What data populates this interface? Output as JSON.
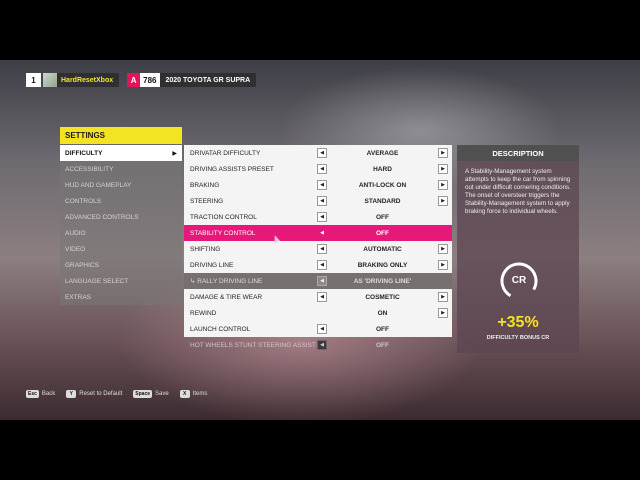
{
  "player": {
    "rank": "1",
    "name": "HardResetXbox",
    "car_class": "A",
    "performance_index": "786",
    "car": "2020 TOYOTA GR SUPRA"
  },
  "menu": {
    "header": "SETTINGS",
    "items": [
      {
        "label": "DIFFICULTY",
        "active": true
      },
      {
        "label": "ACCESSIBILITY"
      },
      {
        "label": "HUD AND GAMEPLAY"
      },
      {
        "label": "CONTROLS"
      },
      {
        "label": "ADVANCED CONTROLS"
      },
      {
        "label": "AUDIO"
      },
      {
        "label": "VIDEO"
      },
      {
        "label": "GRAPHICS"
      },
      {
        "label": "LANGUAGE SELECT"
      },
      {
        "label": "EXTRAS"
      }
    ]
  },
  "options": [
    {
      "label": "DRIVATAR DIFFICULTY",
      "value": "AVERAGE"
    },
    {
      "label": "DRIVING ASSISTS PRESET",
      "value": "HARD"
    },
    {
      "label": "BRAKING",
      "value": "ANTI-LOCK ON"
    },
    {
      "label": "STEERING",
      "value": "STANDARD"
    },
    {
      "label": "TRACTION CONTROL",
      "value": "OFF"
    },
    {
      "label": "STABILITY CONTROL",
      "value": "OFF"
    },
    {
      "label": "SHIFTING",
      "value": "AUTOMATIC"
    },
    {
      "label": "DRIVING LINE",
      "value": "BRAKING ONLY"
    },
    {
      "label": "↳ RALLY DRIVING LINE",
      "value": "AS 'DRIVING LINE'"
    },
    {
      "label": "DAMAGE & TIRE WEAR",
      "value": "COSMETIC"
    },
    {
      "label": "REWIND",
      "value": "ON"
    },
    {
      "label": "LAUNCH CONTROL",
      "value": "OFF"
    },
    {
      "label": "HOT WHEELS STUNT STEERING ASSIST",
      "value": "OFF"
    }
  ],
  "description": {
    "title": "DESCRIPTION",
    "text": "A Stability-Management system attempts to keep the car from spinning out under difficult cornering conditions. The onset of oversteer triggers the Stability-Management system to apply braking force to individual wheels.",
    "badge": "CR",
    "bonus": "+35%",
    "bonus_label": "DIFFICULTY BONUS CR"
  },
  "footer": {
    "back_key": "Esc",
    "back_label": "Back",
    "reset_key": "Y",
    "reset_label": "Reset to Default",
    "save_key": "Space",
    "save_label": "Save",
    "items_key": "X",
    "items_label": "Items"
  },
  "colors": {
    "accent_yellow": "#f4e323",
    "selection_pink": "#e6197a",
    "class_badge": "#e3135c"
  }
}
